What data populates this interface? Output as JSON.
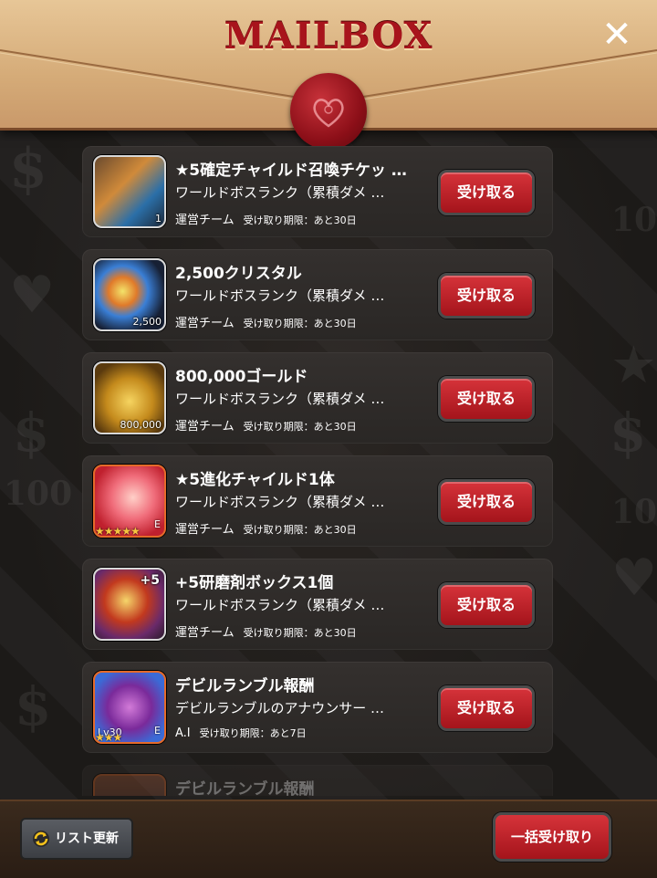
{
  "header": {
    "title": "MAILBOX",
    "close_glyph": "✕"
  },
  "background": {
    "glyphs": [
      "$",
      "100",
      "♥",
      "$",
      "100",
      "★",
      "$",
      "100",
      "♥",
      "$"
    ]
  },
  "mails": [
    {
      "title": "★5確定チャイルド召喚チケッ …",
      "description": "ワールドボスランク（累積ダメ …",
      "sender": "運営チーム",
      "deadline": "受け取り期限：あと30日",
      "receive_label": "受け取る",
      "thumb_qty": "1",
      "icon": "ticket-icon"
    },
    {
      "title": "2,500クリスタル",
      "description": "ワールドボスランク（累積ダメ …",
      "sender": "運営チーム",
      "deadline": "受け取り期限：あと30日",
      "receive_label": "受け取る",
      "thumb_qty": "2,500",
      "icon": "crystal-icon"
    },
    {
      "title": "800,000ゴールド",
      "description": "ワールドボスランク（累積ダメ …",
      "sender": "運営チーム",
      "deadline": "受け取り期限：あと30日",
      "receive_label": "受け取る",
      "thumb_qty": "800,000",
      "icon": "gold-coins-icon"
    },
    {
      "title": "★5進化チャイルド1体",
      "description": "ワールドボスランク（累積ダメ …",
      "sender": "運営チーム",
      "deadline": "受け取り期限：あと30日",
      "receive_label": "受け取る",
      "thumb_rank": "E",
      "thumb_stars": "★★★★★",
      "icon": "pink-child-icon"
    },
    {
      "title": "+5研磨剤ボックス1個",
      "description": "ワールドボスランク（累積ダメ …",
      "sender": "運営チーム",
      "deadline": "受け取り期限：あと30日",
      "receive_label": "受け取る",
      "thumb_badge": "+5",
      "icon": "polish-box-icon"
    },
    {
      "title": "デビルランブル報酬",
      "description": "デビルランブルのアナウンサー …",
      "sender": "A.I",
      "deadline": "受け取り期限：あと7日",
      "receive_label": "受け取る",
      "thumb_lv": "Lv30",
      "thumb_rank": "E",
      "thumb_stars": "★★★",
      "icon": "purple-child-icon"
    },
    {
      "title": "デビルランブル報酬"
    }
  ],
  "footer": {
    "refresh_label": "リスト更新",
    "receive_all_label": "一括受け取り"
  },
  "colors": {
    "accent_red": "#b81c24",
    "title_red": "#a8141c",
    "parchment": "#d9b07c"
  }
}
